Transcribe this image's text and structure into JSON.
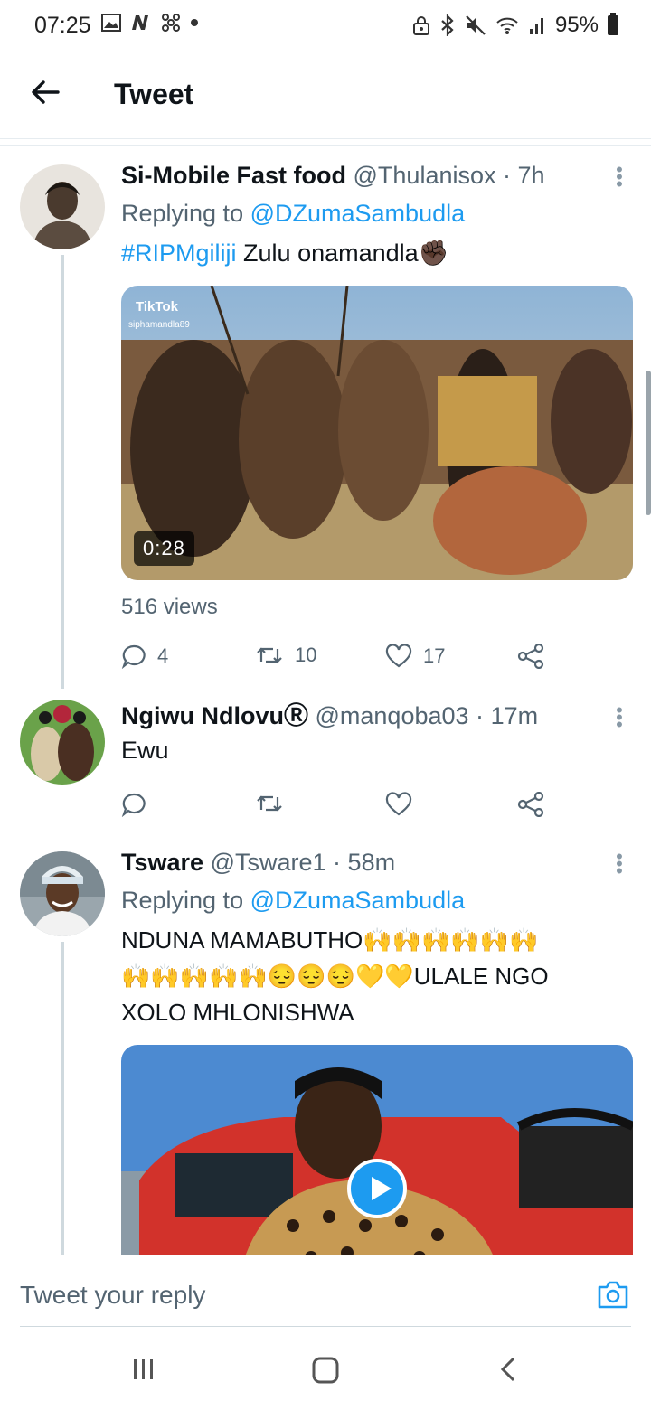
{
  "status_bar": {
    "time": "07:25",
    "battery": "95%",
    "left_icons": [
      "image-icon",
      "n-icon",
      "fan-icon",
      "dot-icon"
    ],
    "right_icons": [
      "lock-icon",
      "bluetooth-icon",
      "mute-icon",
      "wifi-icon",
      "signal-icon",
      "battery-icon"
    ]
  },
  "header": {
    "title": "Tweet"
  },
  "tweets": [
    {
      "name": "Si-Mobile Fast food",
      "handle": "@Thulanisox",
      "sep": "·",
      "time": "7h",
      "replying_prefix": "Replying to",
      "replying_to": "@DZumaSambudla",
      "hashtag": "#RIPMgiliji",
      "text": "Zulu onamandla✊🏿",
      "video_duration": "0:28",
      "watermark": "TikTok",
      "watermark_user": "siphamandla89",
      "views": "516 views",
      "replies": "4",
      "retweets": "10",
      "likes": "17"
    },
    {
      "name": "Ngiwu Ndlovu",
      "badge": "Ⓡ",
      "handle": "@manqoba03",
      "sep": "·",
      "time": "17m",
      "text": "Ewu"
    },
    {
      "name": "Tsware",
      "handle": "@Tsware1",
      "sep": "·",
      "time": "58m",
      "replying_prefix": "Replying to",
      "replying_to": "@DZumaSambudla",
      "text_line1": "NDUNA MAMABUTHO🙌🙌🙌🙌🙌🙌",
      "text_line2": "🙌🙌🙌🙌🙌😔😔😔💛💛ULALE NGO",
      "text_line3": "XOLO MHLONISHWA"
    }
  ],
  "reply_bar": {
    "placeholder": "Tweet your reply"
  },
  "nav": [
    "recents-icon",
    "home-icon",
    "back-icon"
  ],
  "colors": {
    "accent": "#1d9bf0",
    "muted": "#536471",
    "text": "#0f1419"
  }
}
